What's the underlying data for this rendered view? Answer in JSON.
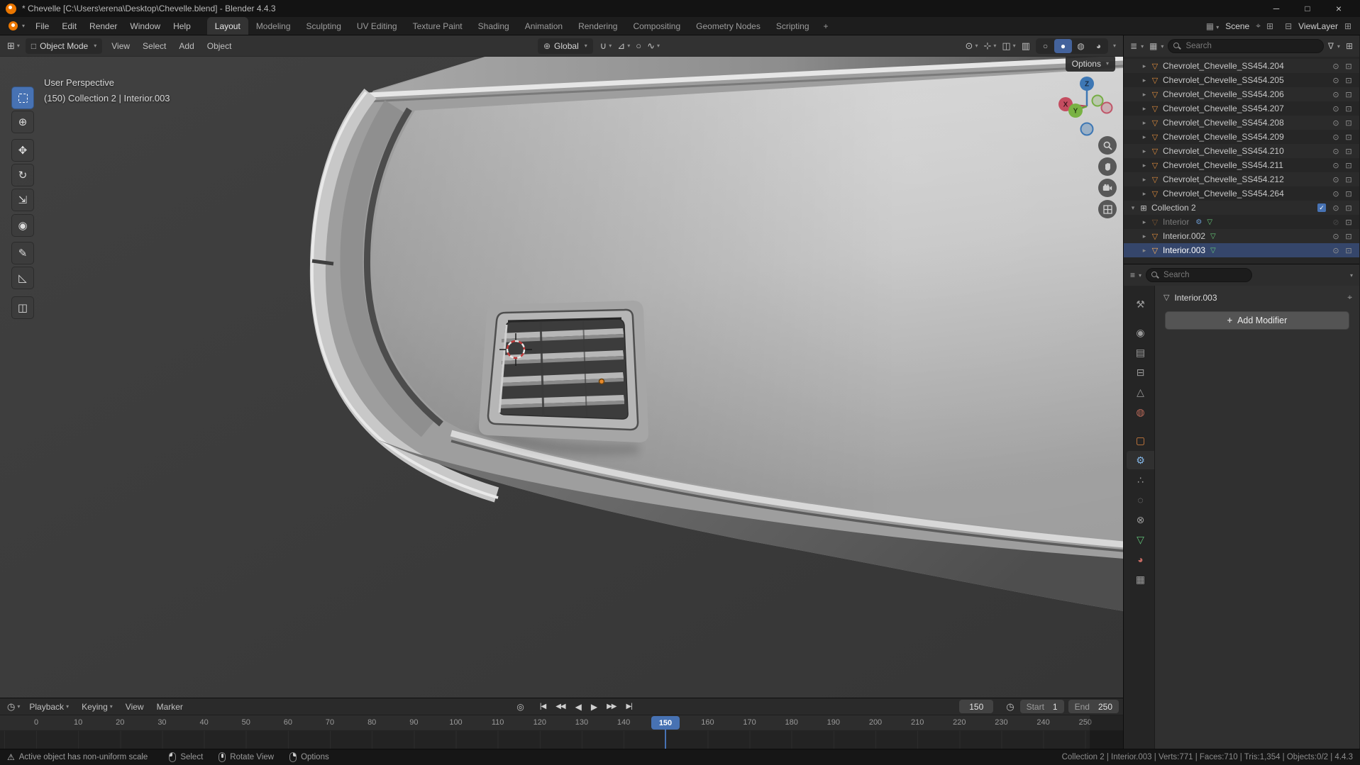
{
  "colors": {
    "accent": "#4772b3",
    "selection_row": "#35466b"
  },
  "title_bar": {
    "title": "* Chevelle [C:\\Users\\erena\\Desktop\\Chevelle.blend] - Blender 4.4.3",
    "window_buttons": [
      "minimize",
      "maximize",
      "close"
    ]
  },
  "topbar": {
    "menus": [
      "File",
      "Edit",
      "Render",
      "Window",
      "Help"
    ],
    "workspaces": [
      "Layout",
      "Modeling",
      "Sculpting",
      "UV Editing",
      "Texture Paint",
      "Shading",
      "Animation",
      "Rendering",
      "Compositing",
      "Geometry Nodes",
      "Scripting"
    ],
    "active_workspace": "Layout",
    "new_workspace_label": "+",
    "scene_label": "Scene",
    "view_layer_label": "ViewLayer"
  },
  "viewport": {
    "header": {
      "mode_label": "Object Mode",
      "menus": [
        "View",
        "Select",
        "Add",
        "Object"
      ],
      "orientation_label": "Global",
      "center_icons": [
        "snap-magnet",
        "snap-target",
        "proportional-editing",
        "proportional-falloff"
      ],
      "right_icons": [
        "visibility-filter",
        "show-gizmos",
        "show-overlays",
        "toggle-xray"
      ],
      "shading_modes": [
        "wireframe",
        "solid",
        "material-preview",
        "rendered"
      ],
      "active_shading": "solid"
    },
    "tools": [
      {
        "icon": "select-box-tool-icon",
        "active": true
      },
      {
        "icon": "cursor-tool-icon"
      },
      {
        "icon": "move-tool-icon"
      },
      {
        "icon": "rotate-tool-icon"
      },
      {
        "icon": "scale-tool-icon"
      },
      {
        "icon": "transform-tool-icon"
      },
      {
        "icon": "annotate-tool-icon"
      },
      {
        "icon": "measure-tool-icon"
      },
      {
        "icon": "add-cube-tool-icon"
      }
    ],
    "overlay": {
      "line1": "User Perspective",
      "line2": "(150) Collection 2 | Interior.003"
    },
    "options_button_label": "Options",
    "axis_labels": {
      "x": "X",
      "y": "Y",
      "z": "Z"
    },
    "nav_buttons": [
      "zoom",
      "pan",
      "camera-view",
      "grid-view"
    ]
  },
  "outliner": {
    "search_placeholder": "Search",
    "rows": [
      {
        "name": "Chevrolet_Chevelle_SS454.204",
        "type": "mesh",
        "indent": 1
      },
      {
        "name": "Chevrolet_Chevelle_SS454.205",
        "type": "mesh",
        "indent": 1
      },
      {
        "name": "Chevrolet_Chevelle_SS454.206",
        "type": "mesh",
        "indent": 1
      },
      {
        "name": "Chevrolet_Chevelle_SS454.207",
        "type": "mesh",
        "indent": 1
      },
      {
        "name": "Chevrolet_Chevelle_SS454.208",
        "type": "mesh",
        "indent": 1
      },
      {
        "name": "Chevrolet_Chevelle_SS454.209",
        "type": "mesh",
        "indent": 1
      },
      {
        "name": "Chevrolet_Chevelle_SS454.210",
        "type": "mesh",
        "indent": 1
      },
      {
        "name": "Chevrolet_Chevelle_SS454.211",
        "type": "mesh",
        "indent": 1
      },
      {
        "name": "Chevrolet_Chevelle_SS454.212",
        "type": "mesh",
        "indent": 1
      },
      {
        "name": "Chevrolet_Chevelle_SS454.264",
        "type": "mesh",
        "indent": 1
      },
      {
        "name": "Collection 2",
        "type": "collection",
        "indent": 0,
        "expanded": true,
        "checkbox": true
      },
      {
        "name": "Interior",
        "type": "mesh",
        "indent": 1,
        "dimmed": true,
        "modifier": true,
        "data_icon": true,
        "hidden": true
      },
      {
        "name": "Interior.002",
        "type": "mesh",
        "indent": 1,
        "data_icon": true
      },
      {
        "name": "Interior.003",
        "type": "mesh",
        "indent": 1,
        "data_icon": true,
        "selected": true
      }
    ]
  },
  "properties": {
    "search_placeholder": "Search",
    "tabs": [
      "tool",
      "render",
      "output",
      "view-layer",
      "scene",
      "world",
      "object",
      "modifiers",
      "particles",
      "physics",
      "constraints",
      "data",
      "material",
      "texture"
    ],
    "active_tab": "modifiers",
    "breadcrumb": "Interior.003",
    "add_modifier_label": "Add Modifier",
    "add_modifier_plus": "+"
  },
  "timeline": {
    "menus": [
      "Playback",
      "Keying",
      "View",
      "Marker"
    ],
    "transport": [
      "jump-start",
      "prev-keyframe",
      "play-reverse",
      "play",
      "next-keyframe",
      "jump-end"
    ],
    "current_frame": "150",
    "start_label": "Start",
    "start_value": "1",
    "end_label": "End",
    "end_value": "250",
    "ruler_ticks": [
      "0",
      "10",
      "20",
      "30",
      "40",
      "50",
      "60",
      "70",
      "80",
      "90",
      "100",
      "110",
      "120",
      "130",
      "140",
      "150",
      "160",
      "170",
      "180",
      "190",
      "200",
      "210",
      "220",
      "230",
      "240",
      "250"
    ],
    "playhead_frame": "150"
  },
  "status_bar": {
    "warning": "Active object has non-uniform scale",
    "hints": [
      {
        "label": "Select",
        "button": "left"
      },
      {
        "label": "Rotate View",
        "button": "middle"
      },
      {
        "label": "Options",
        "button": "right"
      }
    ],
    "stats": [
      "Collection 2",
      "Interior.003",
      "Verts:771",
      "Faces:710",
      "Tris:1,354",
      "Objects:0/2",
      "4.4.3"
    ]
  }
}
